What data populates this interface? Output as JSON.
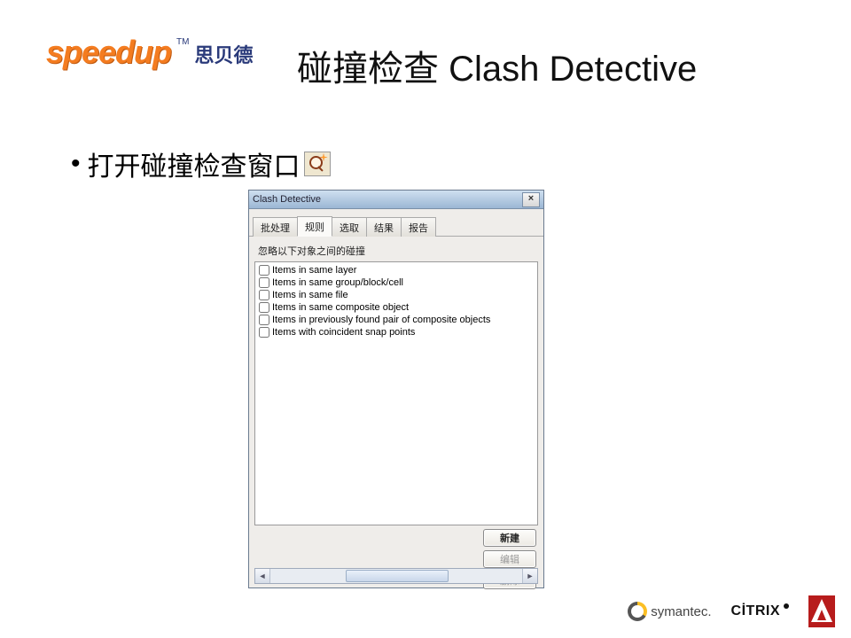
{
  "logo": {
    "en": "speedup",
    "tm": "TM",
    "cn": "思贝德"
  },
  "title": "碰撞检查 Clash Detective",
  "bullet_mark": "•",
  "bullet_text": "打开碰撞检查窗口",
  "window": {
    "title": "Clash Detective",
    "close": "×",
    "tabs": [
      "批处理",
      "规则",
      "选取",
      "结果",
      "报告"
    ],
    "active_tab_index": 1,
    "subtitle": "忽略以下对象之间的碰撞",
    "items": [
      "Items in same layer",
      "Items in same group/block/cell",
      "Items in same file",
      "Items in same composite object",
      "Items in previously found pair of composite objects",
      "Items with coincident snap points"
    ],
    "buttons": {
      "new": "新建",
      "edit": "编辑",
      "delete": "删除"
    }
  },
  "footer": {
    "symantec": "symantec.",
    "citrix": "CİTRIX"
  }
}
